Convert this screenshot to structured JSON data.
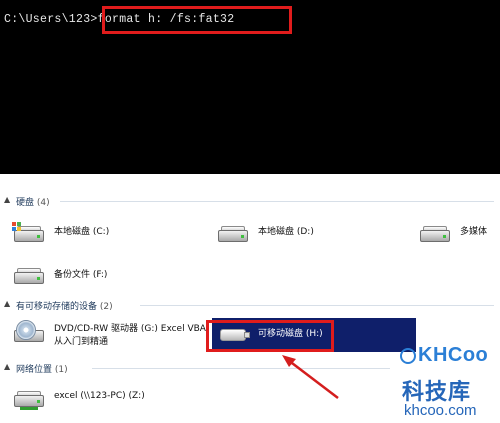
{
  "console": {
    "prompt": "C:\\Users\\123>",
    "command": "format h: /fs:fat32"
  },
  "sections": {
    "hard_disk": {
      "title": "硬盘",
      "count": "(4)"
    },
    "removable": {
      "title": "有可移动存储的设备",
      "count": "(2)"
    },
    "network": {
      "title": "网络位置",
      "count": "(1)"
    }
  },
  "drives": {
    "local_c": "本地磁盘 (C:)",
    "local_d": "本地磁盘 (D:)",
    "media": "多媒体",
    "backup_f": "备份文件 (F:)",
    "dvd_line1": "DVD/CD-RW 驱动器 (G:) Excel VBA",
    "dvd_line2": "从入门到精通",
    "usb_h": "可移动磁盘 (H:)",
    "net_z": "excel (\\\\123-PC) (Z:)"
  },
  "watermark": {
    "logo": "KHCoo",
    "cn": "科技库",
    "site": "khcoo.com"
  },
  "colors": {
    "highlight_box": "#e01c1c",
    "selection": "#0f1f6a",
    "watermark": "#2566b9"
  },
  "icons": {
    "drive": "hard-drive-icon",
    "dvd": "dvd-drive-icon",
    "usb": "usb-drive-icon",
    "network": "network-drive-icon"
  }
}
